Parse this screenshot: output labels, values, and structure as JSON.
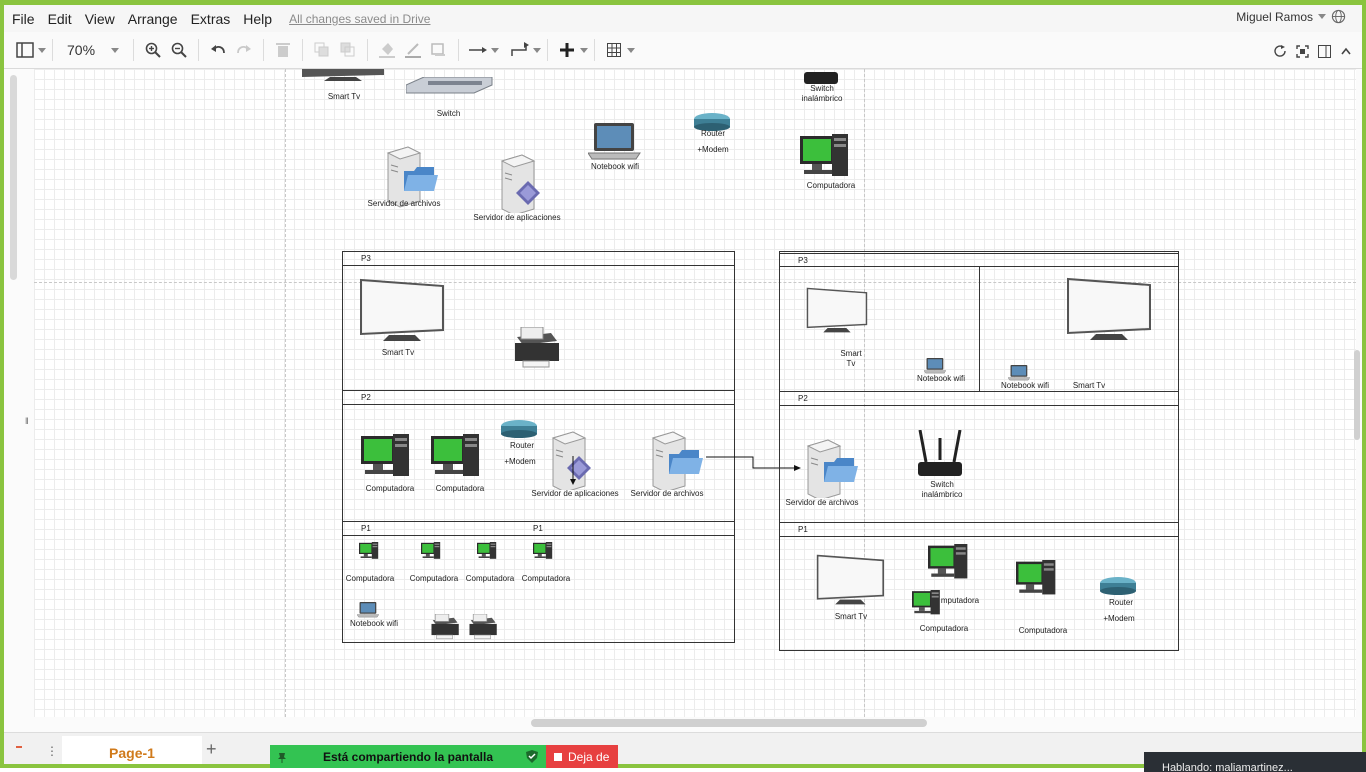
{
  "menubar": {
    "items": [
      "File",
      "Edit",
      "View",
      "Arrange",
      "Extras",
      "Help"
    ],
    "saved_status": "All changes saved in Drive",
    "user_name": "Miguel Ramos"
  },
  "toolbar": {
    "zoom": "70%"
  },
  "canvas": {
    "loose_shapes": {
      "smart_tv": "Smart Tv",
      "switch": "Switch",
      "switch_wireless_1": "Switch",
      "switch_wireless_2": "inalámbrico",
      "notebook": "Notebook wifi",
      "router_1": "Router",
      "router_2": "+Modem",
      "computer": "Computadora",
      "file_server": "Servidor de archivos",
      "app_server": "Servidor de aplicaciones"
    },
    "left_building": {
      "p3": {
        "title": "P3",
        "tv": "Smart Tv"
      },
      "p2": {
        "title": "P2",
        "pc1": "Computadora",
        "pc2": "Computadora",
        "router_1": "Router",
        "router_2": "+Modem",
        "app_server": "Servidor de aplicaciones",
        "file_server": "Servidor de archivos"
      },
      "p1": {
        "title_1": "P1",
        "title_2": "P1",
        "pcs": [
          "Computadora",
          "Computadora",
          "Computadora",
          "Computadora"
        ],
        "notebook": "Notebook wifi"
      }
    },
    "right_building": {
      "p3": {
        "title": "P3",
        "tv_1": "Smart",
        "tv_2": "Tv",
        "notebook_1": "Notebook wifi",
        "notebook_2": "Notebook wifi",
        "tv_right": "Smart Tv"
      },
      "p2": {
        "title": "P2",
        "file_server": "Servidor de archivos",
        "switch_1": "Switch",
        "switch_2": "inalámbrico"
      },
      "p1": {
        "title": "P1",
        "tv": "Smart Tv",
        "pc_overlap_1": "mputadora",
        "pc_overlap_2": "Computadora",
        "pc_3": "Computadora",
        "router_1": "Router",
        "router_2": "+Modem"
      }
    }
  },
  "bottom": {
    "page_tab": "Page-1",
    "share_text": "Está compartiendo la pantalla",
    "stop_text": "Deja de",
    "popup_text": "Hablando: maliamartinez..."
  },
  "colors": {
    "frame": "#8ac43f",
    "page_tab": "#d07a1b",
    "share_green": "#33c352",
    "share_red": "#e74040"
  }
}
